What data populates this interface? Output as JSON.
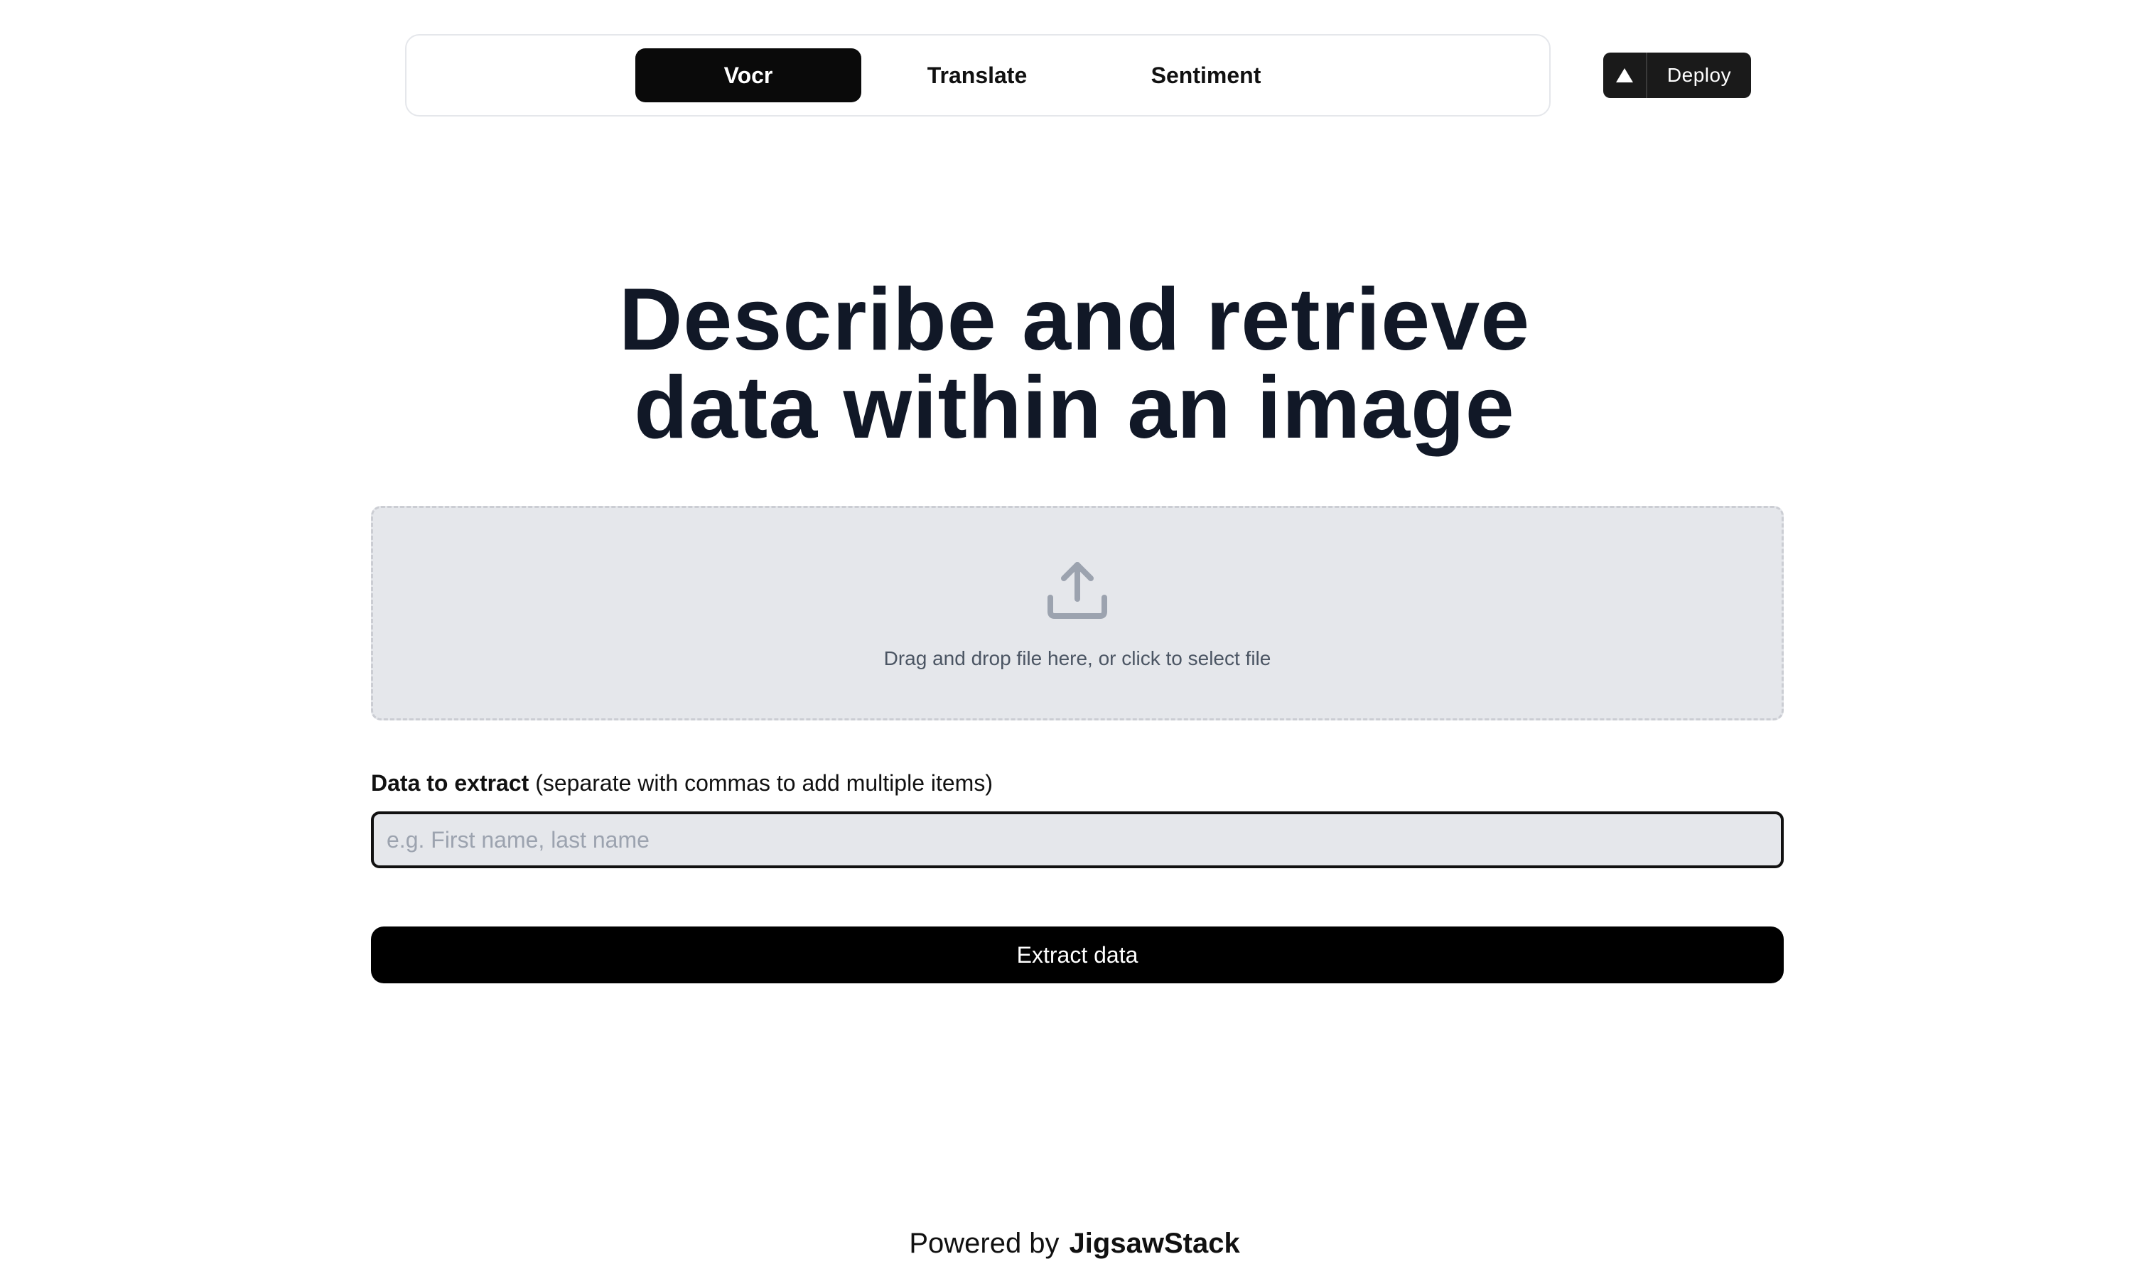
{
  "nav": {
    "tabs": [
      {
        "label": "Vocr",
        "active": true
      },
      {
        "label": "Translate",
        "active": false
      },
      {
        "label": "Sentiment",
        "active": false
      }
    ],
    "deploy_label": "Deploy",
    "deploy_icon": "triangle-icon"
  },
  "hero": {
    "line1": "Describe and retrieve",
    "line2": "data within an image"
  },
  "dropzone": {
    "icon": "upload-icon",
    "text": "Drag and drop file here, or click to select file"
  },
  "extract_field": {
    "label_bold": "Data to extract",
    "label_rest": " (separate with commas to add multiple items)",
    "value": "",
    "placeholder": "e.g. First name, last name"
  },
  "extract_button": {
    "label": "Extract data"
  },
  "footer": {
    "prefix": "Powered by",
    "brand": "JigsawStack"
  },
  "colors": {
    "accent": "#0a0a0a",
    "dropzone_bg": "#e5e7eb",
    "heading": "#111827"
  }
}
